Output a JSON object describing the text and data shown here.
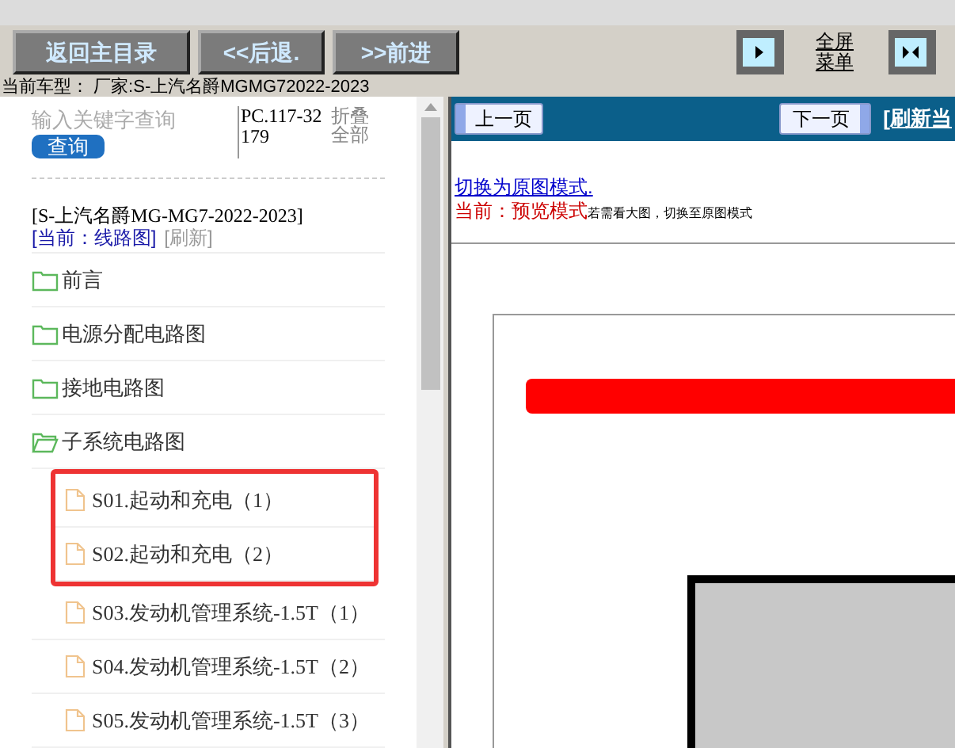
{
  "toolbar": {
    "buttons": [
      "返回主目录",
      "<<后退.",
      ">>前进"
    ],
    "fullscreen_label": "全屏菜单"
  },
  "car_model": "当前车型：  厂家:S-上汽名爵MGMG72022-2023",
  "sidebar": {
    "search": {
      "placeholder": "输入关键字查询",
      "button": "查询"
    },
    "code": "PC.117-32179",
    "collapse_all": "折叠全部",
    "title": "[S-上汽名爵MG-MG7-2022-2023]",
    "current": "[当前：线路图]",
    "refresh": "[刷新]",
    "items": [
      {
        "label": "前言",
        "kind": "folder",
        "expanded": false
      },
      {
        "label": "电源分配电路图",
        "kind": "folder",
        "expanded": false
      },
      {
        "label": "接地电路图",
        "kind": "folder",
        "expanded": false
      },
      {
        "label": "子系统电路图",
        "kind": "folder",
        "expanded": true,
        "children": [
          {
            "label": "S01.起动和充电（1）",
            "kind": "file",
            "marked": true
          },
          {
            "label": "S02.起动和充电（2）",
            "kind": "file",
            "marked": true
          },
          {
            "label": "S03.发动机管理系统-1.5T（1）",
            "kind": "file",
            "marked": false
          },
          {
            "label": "S04.发动机管理系统-1.5T（2）",
            "kind": "file",
            "marked": false
          },
          {
            "label": "S05.发动机管理系统-1.5T（3）",
            "kind": "file",
            "marked": false
          }
        ]
      }
    ]
  },
  "viewer": {
    "prev": "上一页",
    "next": "下一页",
    "refresh": "[刷新当",
    "switch_link": "切换为原图模式.",
    "mode_label": "当前：预览模式",
    "mode_hint": "若需看大图，切换至原图模式"
  }
}
